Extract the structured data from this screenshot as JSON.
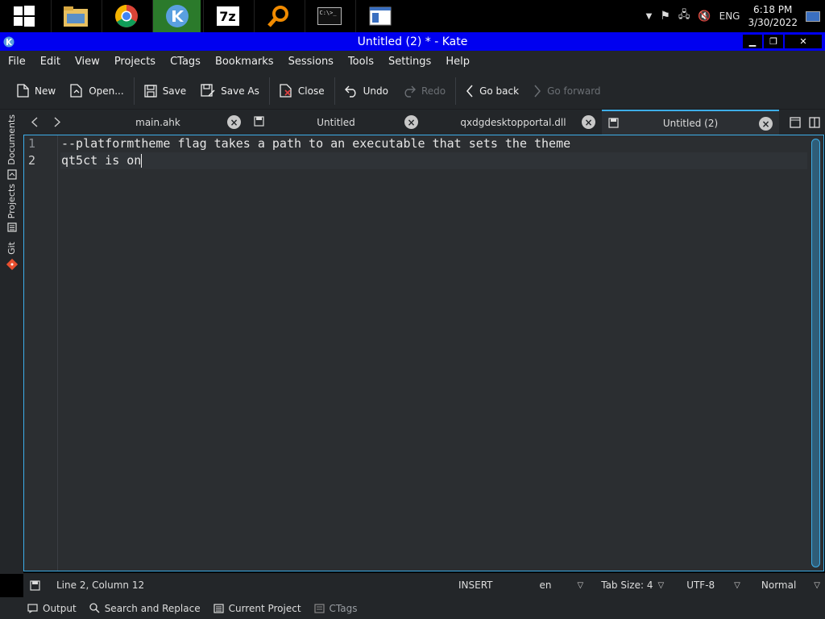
{
  "taskbar": {
    "apps": [
      {
        "name": "start-icon"
      },
      {
        "name": "file-manager-icon"
      },
      {
        "name": "chrome-icon"
      },
      {
        "name": "kate-icon",
        "active": true
      },
      {
        "name": "sevenzip-icon",
        "label": "7z"
      },
      {
        "name": "search-tool-icon"
      },
      {
        "name": "terminal-icon",
        "label": "C:\\>_"
      },
      {
        "name": "window-app-icon"
      }
    ],
    "language": "ENG",
    "time": "6:18 PM",
    "date": "3/30/2022"
  },
  "window": {
    "title": "Untitled (2) * - Kate",
    "minimize": "▁",
    "restore": "❐",
    "close": "✕"
  },
  "menu": [
    "File",
    "Edit",
    "View",
    "Projects",
    "CTags",
    "Bookmarks",
    "Sessions",
    "Tools",
    "Settings",
    "Help"
  ],
  "toolbar": {
    "new": "New",
    "open": "Open...",
    "save": "Save",
    "save_as": "Save As",
    "close": "Close",
    "undo": "Undo",
    "redo": "Redo",
    "go_back": "Go back",
    "go_forward": "Go forward"
  },
  "sidebar": {
    "documents": "Documents",
    "projects": "Projects",
    "git": "Git"
  },
  "tabs": [
    {
      "label": "main.ahk"
    },
    {
      "label": "Untitled"
    },
    {
      "label": "qxdgdesktopportal.dll"
    },
    {
      "label": "Untitled (2)"
    }
  ],
  "editor": {
    "line_numbers": [
      "1",
      "2"
    ],
    "lines": [
      "--platformtheme flag takes a path to an executable that sets the theme",
      "qt5ct is on"
    ]
  },
  "status": {
    "position": "Line 2, Column 12",
    "mode": "INSERT",
    "language": "en",
    "tab_size": "Tab Size: 4",
    "encoding": "UTF-8",
    "highlight": "Normal"
  },
  "bottom_panel": {
    "output": "Output",
    "search_replace": "Search and Replace",
    "current_project": "Current Project",
    "ctags": "CTags"
  },
  "colors": {
    "accent": "#3daee9",
    "titlebar": "#0000f0",
    "panel": "#232629",
    "editor_bg": "#2b2e31"
  }
}
